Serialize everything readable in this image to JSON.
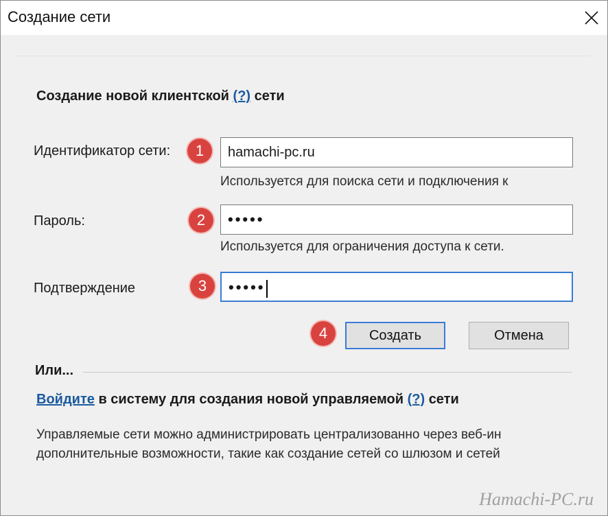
{
  "window": {
    "title": "Создание сети",
    "close_icon": "close-icon"
  },
  "form": {
    "heading_prefix": "Создание новой клиентской",
    "heading_help": "(?)",
    "heading_suffix": "сети",
    "network_id": {
      "label": "Идентификатор сети:",
      "value": "hamachi-pc.ru",
      "hint": "Используется для поиска сети и подключения к"
    },
    "password": {
      "label": "Пароль:",
      "value": "•••••",
      "hint": "Используется для ограничения доступа к сети."
    },
    "confirm": {
      "label": "Подтверждение",
      "value": "•••••"
    },
    "create_label": "Создать",
    "cancel_label": "Отмена"
  },
  "badges": [
    "1",
    "2",
    "3",
    "4"
  ],
  "alt": {
    "or_label": "Или...",
    "signin_link": "Войдите",
    "signin_text": "в систему для создания новой управляемой",
    "signin_help": "(?)",
    "signin_suffix": "сети",
    "desc_line1": "Управляемые сети можно администрировать централизованно через веб-ин",
    "desc_line2": "дополнительные возможности, такие как создание сетей со шлюзом и сетей"
  },
  "watermark": "Hamachi-PC.ru",
  "colors": {
    "badge": "#d9433f",
    "link": "#1a5a9e",
    "focus": "#3a7bd5"
  }
}
